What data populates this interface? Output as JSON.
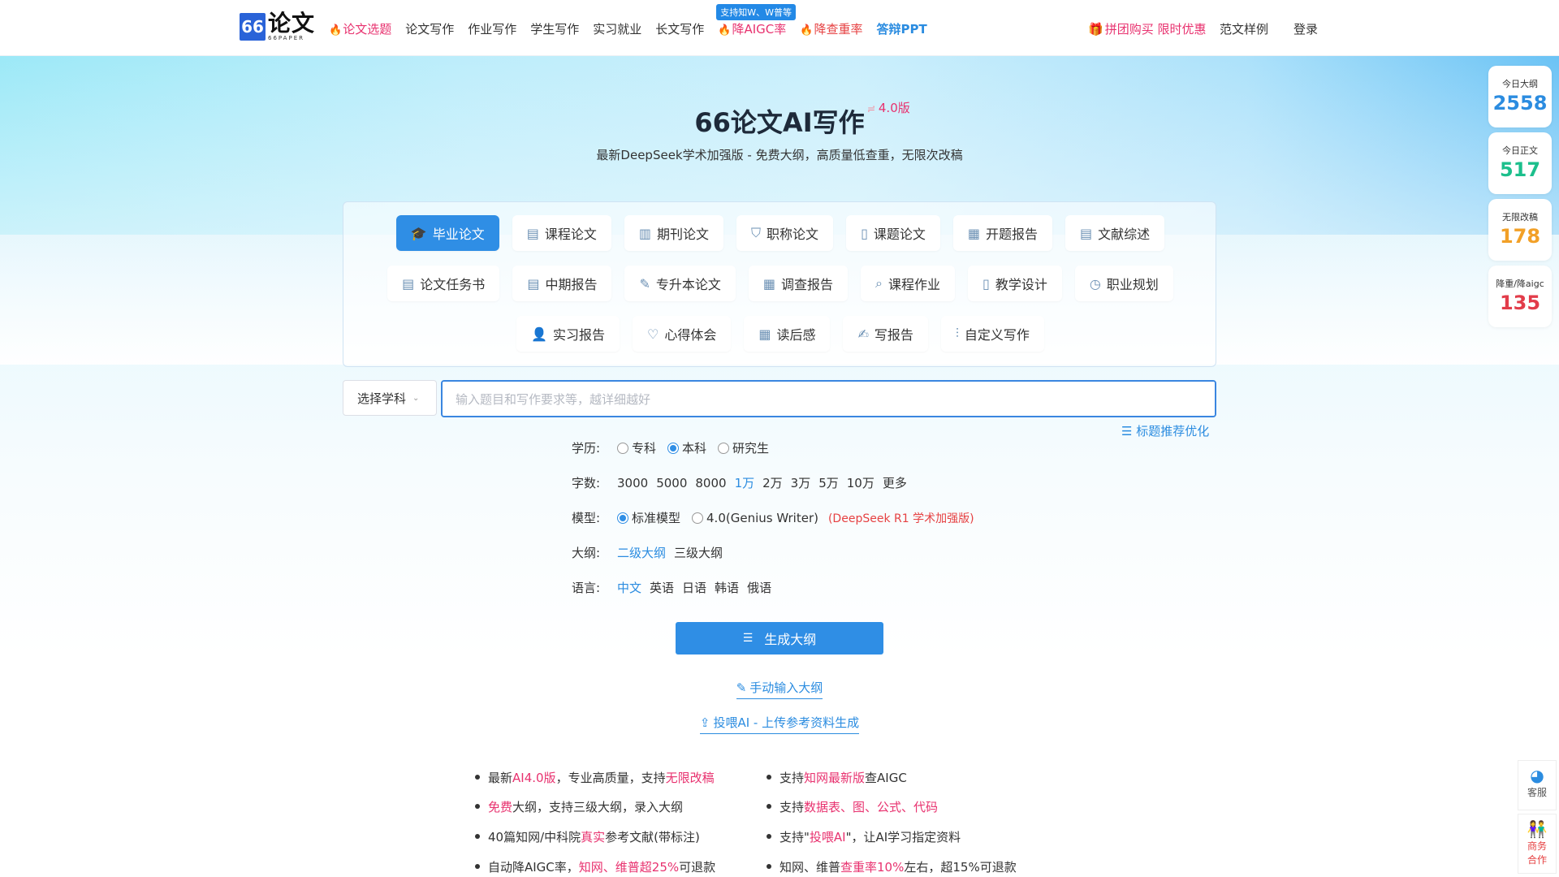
{
  "logo": {
    "mark": "66",
    "name": "论文",
    "sub": "66PAPER"
  },
  "nav": [
    {
      "label": "论文选题",
      "hot": true
    },
    {
      "label": "论文写作"
    },
    {
      "label": "作业写作"
    },
    {
      "label": "学生写作"
    },
    {
      "label": "实习就业"
    },
    {
      "label": "长文写作"
    },
    {
      "label": "降AIGC率",
      "hot": true,
      "badge": "支持知W、W普等"
    },
    {
      "label": "降查重率",
      "hot": true
    },
    {
      "label": "答辩PPT"
    }
  ],
  "nav_right": {
    "promo": "拼团购买 限时优惠",
    "samples": "范文样例",
    "login": "登录"
  },
  "hero": {
    "title": "66论文AI写作",
    "version": "4.0版",
    "subtitle": "最新DeepSeek学术加强版 - 免费大纲，高质量低查重，无限次改稿"
  },
  "categories": [
    [
      {
        "label": "毕业论文",
        "icon": "graduation-cap-icon",
        "active": true
      },
      {
        "label": "课程论文",
        "icon": "document-icon"
      },
      {
        "label": "期刊论文",
        "icon": "journal-icon"
      },
      {
        "label": "职称论文",
        "icon": "shield-icon"
      },
      {
        "label": "课题论文",
        "icon": "bookmark-icon"
      },
      {
        "label": "开题报告",
        "icon": "report-icon"
      },
      {
        "label": "文献综述",
        "icon": "literature-icon"
      }
    ],
    [
      {
        "label": "论文任务书",
        "icon": "clipboard-icon"
      },
      {
        "label": "中期报告",
        "icon": "clipboard-icon"
      },
      {
        "label": "专升本论文",
        "icon": "edit-doc-icon"
      },
      {
        "label": "调查报告",
        "icon": "survey-icon"
      },
      {
        "label": "课程作业",
        "icon": "search-doc-icon"
      },
      {
        "label": "教学设计",
        "icon": "book-icon"
      },
      {
        "label": "职业规划",
        "icon": "clock-icon"
      }
    ],
    [
      {
        "label": "实习报告",
        "icon": "user-icon"
      },
      {
        "label": "心得体会",
        "icon": "heart-icon"
      },
      {
        "label": "读后感",
        "icon": "calendar-icon"
      },
      {
        "label": "写报告",
        "icon": "write-doc-icon"
      },
      {
        "label": "自定义写作",
        "icon": "sliders-icon"
      }
    ]
  ],
  "form": {
    "subject_placeholder": "选择学科",
    "topic_placeholder": "输入题目和写作要求等，越详细越好",
    "optimize_label": "标题推荐优化",
    "education": {
      "label": "学历:",
      "options": [
        "专科",
        "本科",
        "研究生"
      ],
      "selected": "本科"
    },
    "words": {
      "label": "字数:",
      "options": [
        "3000",
        "5000",
        "8000",
        "1万",
        "2万",
        "3万",
        "5万",
        "10万",
        "更多"
      ],
      "selected": "1万"
    },
    "model": {
      "label": "模型:",
      "options": [
        "标准模型",
        "4.0(Genius Writer)"
      ],
      "selected": "标准模型",
      "note": "(DeepSeek R1 学术加强版)"
    },
    "outline": {
      "label": "大纲:",
      "options": [
        "二级大纲",
        "三级大纲"
      ],
      "selected": "二级大纲"
    },
    "language": {
      "label": "语言:",
      "options": [
        "中文",
        "英语",
        "日语",
        "韩语",
        "俄语"
      ],
      "selected": "中文"
    },
    "generate_label": "生成大纲",
    "manual_outline": "手动输入大纲",
    "upload_ai": "投喂AI - 上传参考资料生成"
  },
  "features_left": [
    [
      "最新",
      "AI4.0版",
      "，专业高质量，支持",
      "无限改稿",
      ""
    ],
    [
      "",
      "免费",
      "大纲，支持三级大纲，录入大纲",
      "",
      ""
    ],
    [
      "40篇知网/中科院",
      "真实",
      "参考文献(带标注)",
      "",
      ""
    ],
    [
      "自动降AIGC率，",
      "知网、维普超25%",
      "可退款",
      "",
      ""
    ]
  ],
  "features_right": [
    [
      "支持",
      "知网最新版",
      "查AIGC",
      "",
      ""
    ],
    [
      "支持",
      "数据表、图、公式、代码",
      "",
      "",
      ""
    ],
    [
      "支持\"",
      "投喂AI",
      "\"，让AI学习指定资料",
      "",
      ""
    ],
    [
      "知网、维普",
      "查重率10%",
      "左右，超15%可退款",
      "",
      ""
    ]
  ],
  "stats": [
    {
      "label": "今日大纲",
      "value": "2558",
      "color": "#2b8ce0"
    },
    {
      "label": "今日正文",
      "value": "517",
      "color": "#1cbf8c"
    },
    {
      "label": "无限改稿",
      "value": "178",
      "color": "#f2a027"
    },
    {
      "label": "降重/降aigc",
      "value": "135",
      "color": "#e23c4a"
    }
  ],
  "side": {
    "service": "客服",
    "business": "商务合作"
  }
}
